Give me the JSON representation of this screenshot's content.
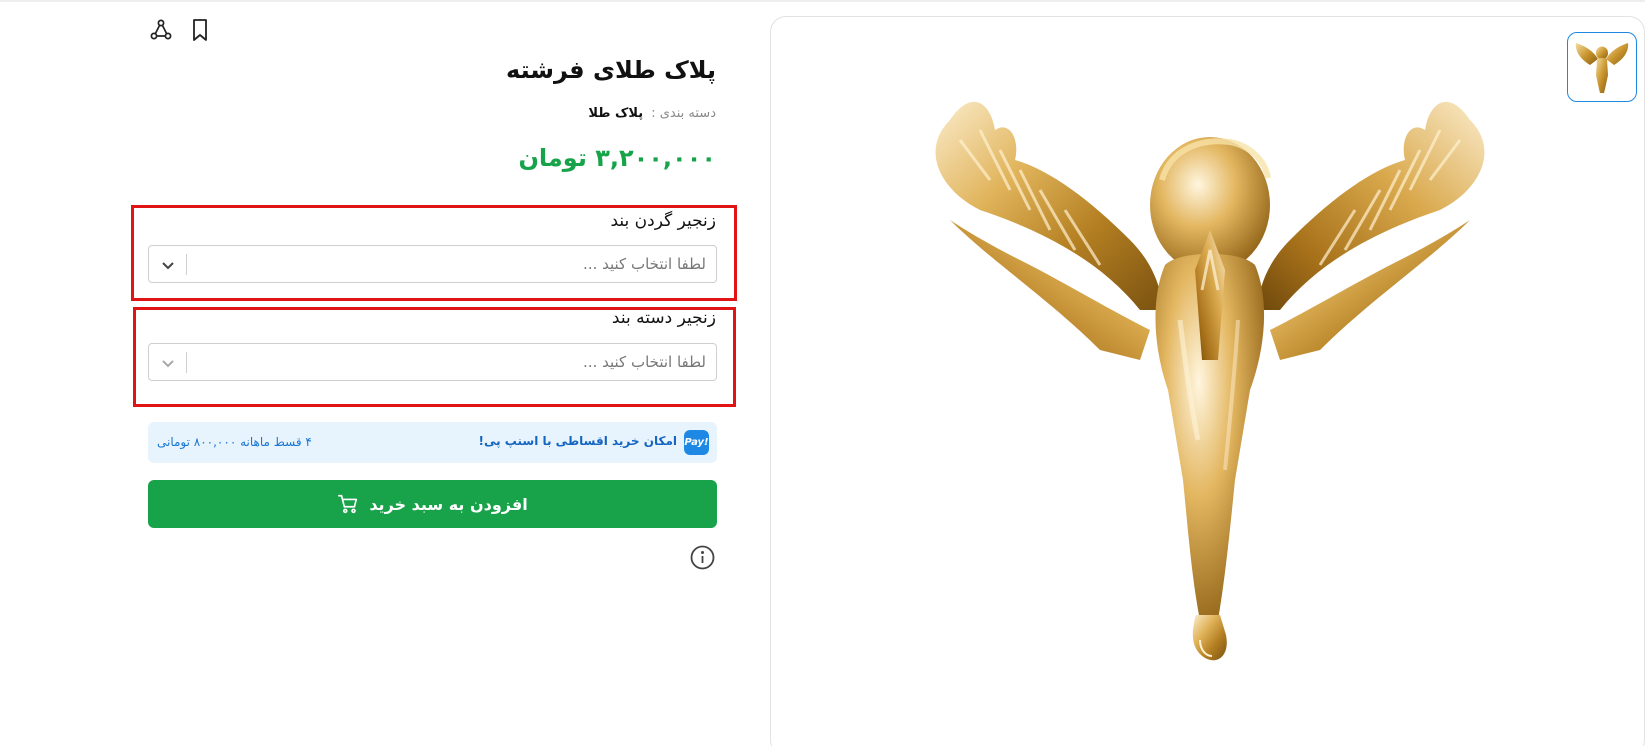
{
  "product": {
    "title": "پلاک طلای فرشته",
    "category_label": "دسته بندی :",
    "category_value": "پلاک طلا",
    "price": "۳,۲۰۰,۰۰۰ تومان"
  },
  "options": [
    {
      "label": "زنجیر گردن بند",
      "placeholder": "لطفا انتخاب کنید ..."
    },
    {
      "label": "زنجیر دسته بند",
      "placeholder": "لطفا انتخاب کنید ..."
    }
  ],
  "snappay": {
    "logo": "Pay!",
    "text": "امکان خرید اقساطی با اسنپ پی!",
    "installment": "۴ قسط ماهانه ۸۰۰,۰۰۰ تومانی"
  },
  "cart": {
    "label": "افزودن به سبد خرید"
  },
  "icons": {
    "share": "share-icon",
    "bookmark": "bookmark-icon",
    "chevron": "chevron-down-icon",
    "cart": "cart-icon",
    "info": "info-icon"
  },
  "colors": {
    "price": "#16a34a",
    "primary_button": "#18a34a",
    "highlight": "#e01414",
    "snappay_bg": "#e8f4fd",
    "snappay_text": "#1565c0",
    "thumb_border": "#1e88e5"
  }
}
